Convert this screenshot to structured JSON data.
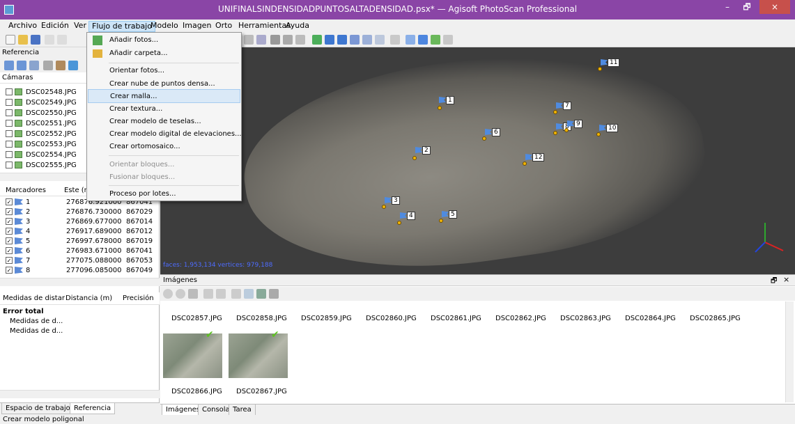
{
  "window": {
    "title": "UNIFINALSINDENSIDADPUNTOSALTADENSIDAD.psx* — Agisoft PhotoScan Professional",
    "controls": [
      "–",
      "🗗",
      "×"
    ]
  },
  "menu": [
    "Archivo",
    "Edición",
    "Ver",
    "Flujo de trabajo",
    "Modelo",
    "Imagen",
    "Orto",
    "Herramientas",
    "Ayuda"
  ],
  "workflow_menu": {
    "items": [
      "Añadir fotos...",
      "Añadir carpeta...",
      "Orientar fotos...",
      "Crear nube de puntos densa...",
      "Crear malla...",
      "Crear textura...",
      "Crear modelo de teselas...",
      "Crear modelo digital de elevaciones...",
      "Crear ortomosaico...",
      "Orientar bloques...",
      "Fusionar bloques...",
      "Proceso por lotes..."
    ]
  },
  "reference": {
    "title": "Referencia",
    "cameras_header": "Cámaras",
    "cameras": [
      "DSC02548.JPG",
      "DSC02549.JPG",
      "DSC02550.JPG",
      "DSC02551.JPG",
      "DSC02552.JPG",
      "DSC02553.JPG",
      "DSC02554.JPG",
      "DSC02555.JPG"
    ],
    "markers_cols": [
      "Marcadores",
      "Este (m"
    ],
    "markers": [
      {
        "n": "1",
        "e": "276876.921000",
        "nv": "867041"
      },
      {
        "n": "2",
        "e": "276876.730000",
        "nv": "867029"
      },
      {
        "n": "3",
        "e": "276869.677000",
        "nv": "867014"
      },
      {
        "n": "4",
        "e": "276917.689000",
        "nv": "867012"
      },
      {
        "n": "5",
        "e": "276997.678000",
        "nv": "867019"
      },
      {
        "n": "6",
        "e": "276983.671000",
        "nv": "867041"
      },
      {
        "n": "7",
        "e": "277075.088000",
        "nv": "867053"
      },
      {
        "n": "8",
        "e": "277096.085000",
        "nv": "867049"
      }
    ],
    "measures_cols": [
      "Medidas de distar",
      "Distancia (m)",
      "Precisión"
    ],
    "total_error": "Error total",
    "measures": [
      "Medidas de d...",
      "Medidas de d..."
    ]
  },
  "left_tabs": [
    "Espacio de trabajo",
    "Referencia"
  ],
  "viewport": {
    "stats": "faces: 1,953,134 vertices: 979,188",
    "markers": [
      "1",
      "2",
      "3",
      "4",
      "5",
      "6",
      "7",
      "8",
      "9",
      "10",
      "11",
      "12"
    ]
  },
  "images": {
    "title": "Imágenes",
    "row1": [
      "DSC02857.JPG",
      "DSC02858.JPG",
      "DSC02859.JPG",
      "DSC02860.JPG",
      "DSC02861.JPG",
      "DSC02862.JPG",
      "DSC02863.JPG",
      "DSC02864.JPG",
      "DSC02865.JPG"
    ],
    "row2": [
      "DSC02866.JPG",
      "DSC02867.JPG"
    ],
    "tabs": [
      "Imágenes",
      "Consola",
      "Tarea"
    ]
  },
  "status": "Crear modelo poligonal"
}
